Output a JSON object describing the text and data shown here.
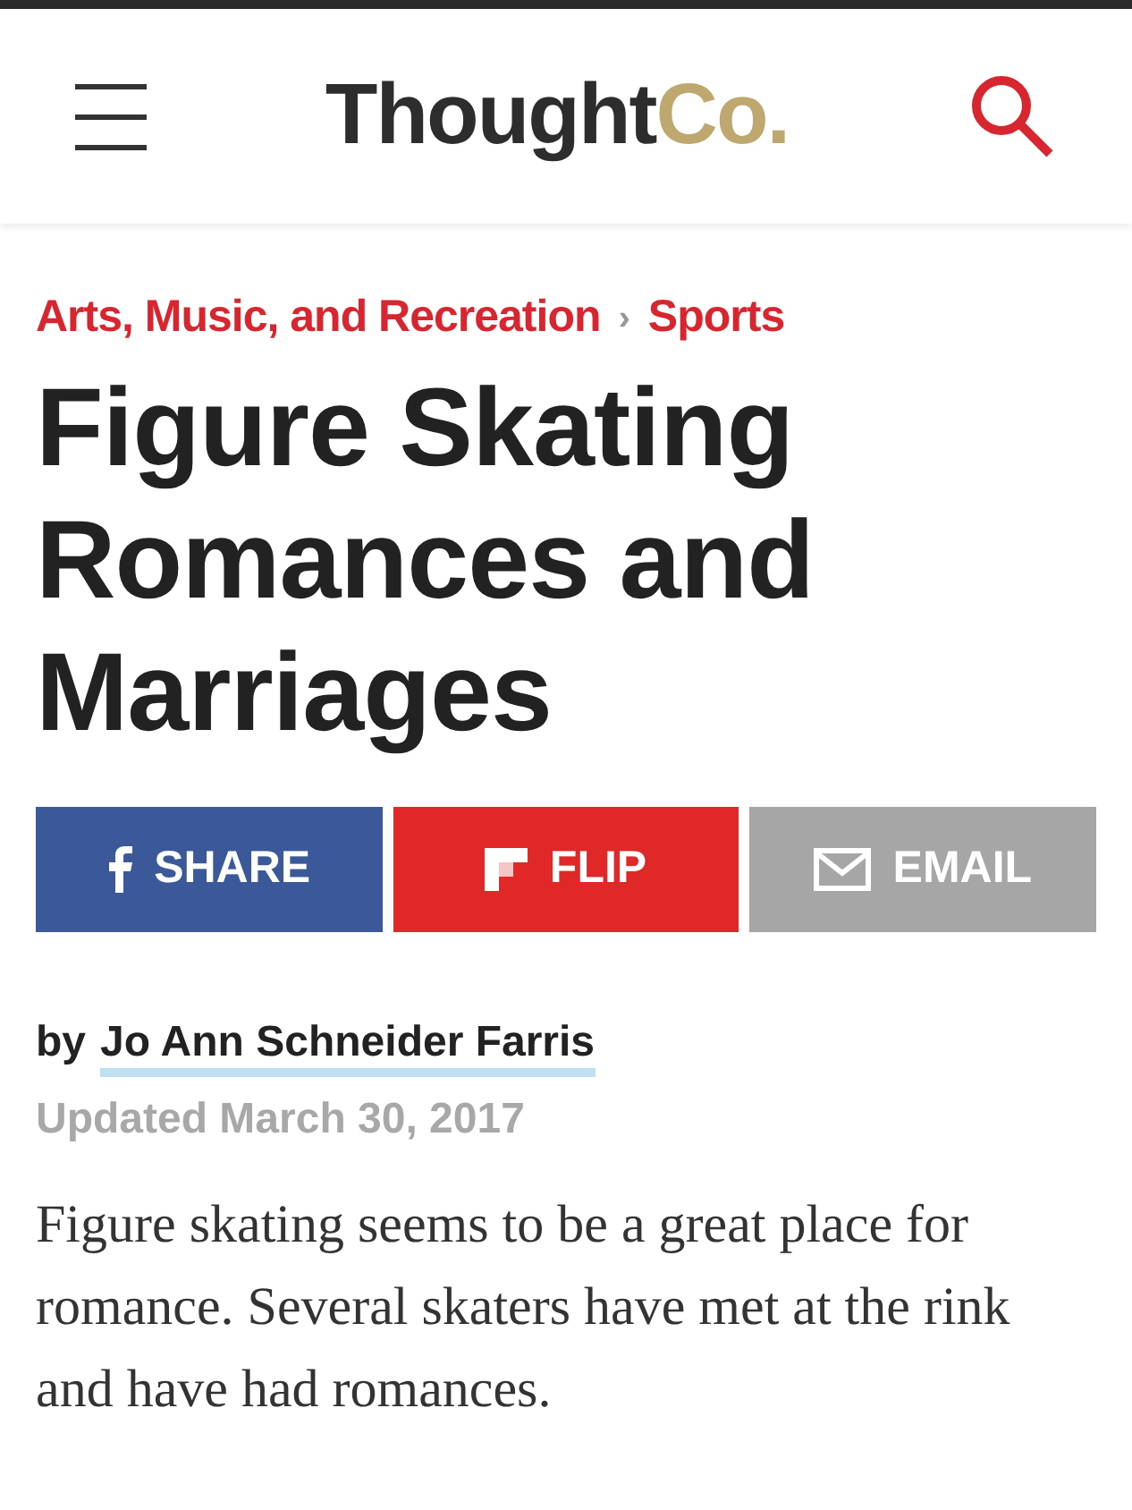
{
  "header": {
    "logo": {
      "main": "Thought",
      "accent": "Co."
    }
  },
  "breadcrumbs": [
    {
      "label": "Arts, Music, and Recreation"
    },
    {
      "label": "Sports"
    }
  ],
  "breadcrumb_separator": "›",
  "title": "Figure Skating Romances and Marriages",
  "share_buttons": [
    {
      "kind": "facebook",
      "label": "SHARE",
      "color": "#3b5998"
    },
    {
      "kind": "flipboard",
      "label": "FLIP",
      "color": "#e12828"
    },
    {
      "kind": "email",
      "label": "EMAIL",
      "color": "#a6a6a6"
    }
  ],
  "byline": {
    "prefix": "by",
    "author": "Jo Ann Schneider Farris"
  },
  "updated": "Updated March 30, 2017",
  "body": "Figure skating seems to be a great place for romance. Several skaters have met at the rink and have had romances."
}
